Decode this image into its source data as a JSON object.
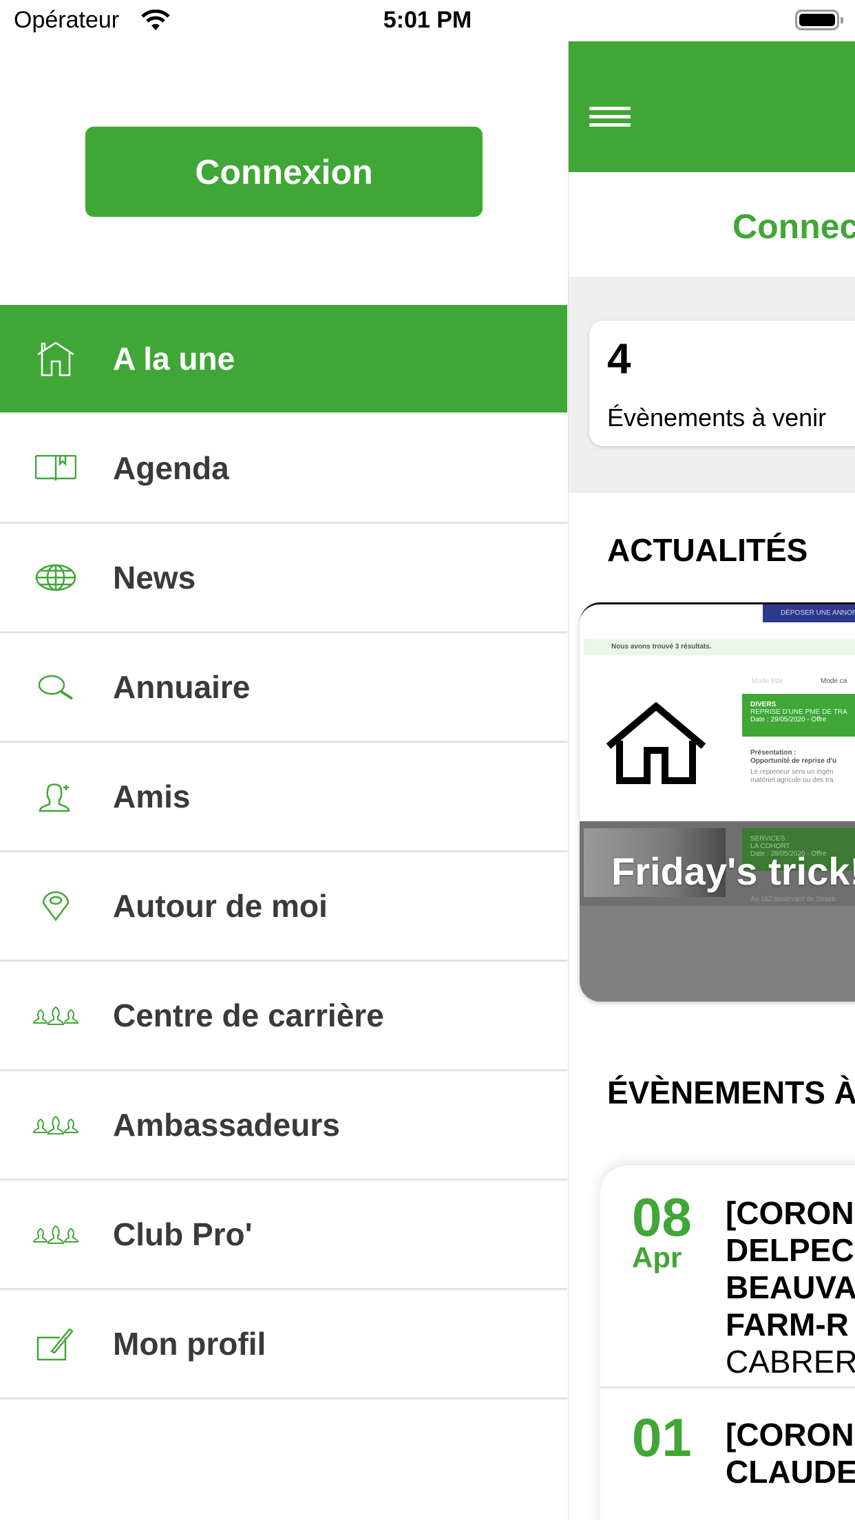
{
  "status_bar": {
    "carrier": "Opérateur",
    "time": "5:01 PM",
    "wifi_icon": "wifi-icon",
    "battery_icon": "battery-icon"
  },
  "drawer": {
    "login_label": "Connexion",
    "items": [
      {
        "label": "A la une",
        "icon": "home-icon",
        "active": true
      },
      {
        "label": "Agenda",
        "icon": "book-icon"
      },
      {
        "label": "News",
        "icon": "globe-icon"
      },
      {
        "label": "Annuaire",
        "icon": "search-icon"
      },
      {
        "label": "Amis",
        "icon": "add-friend-icon"
      },
      {
        "label": "Autour de moi",
        "icon": "location-pin-icon"
      },
      {
        "label": "Centre de carrière",
        "icon": "group-icon"
      },
      {
        "label": "Ambassadeurs",
        "icon": "group-icon"
      },
      {
        "label": "Club Pro'",
        "icon": "group-icon"
      },
      {
        "label": "Mon profil",
        "icon": "edit-icon"
      }
    ]
  },
  "main": {
    "menu_icon": "hamburger-icon",
    "connect_label": "Connect",
    "stat": {
      "value": "4",
      "label": "Évènements à venir"
    },
    "news_heading": "ACTUALITÉS",
    "news": [
      {
        "title": "Friday's trick!",
        "thumbnail_text": {
          "button": "DÉPOSER UNE ANNON",
          "result": "Nous avons trouvé 3 résultats.",
          "mode_list": "Mode liste",
          "mode_map": "Mode ca",
          "cat1": "DIVERS",
          "sub1": "REPRISE D'UNE PME DE TRA",
          "date1": "Date : 29/05/2020 - Offre",
          "pres_label": "Présentation :",
          "pres_title": "Opportunité de reprise d'u",
          "pres_text1": "Le repreneur sera un ingén",
          "pres_text2": "matériel agricole ou des tra",
          "cat2": "SERVICES",
          "sub2": "LA COHORT",
          "date2": "Date : 28/05/2020 - Offre",
          "addr2": "Au 162 boulevard de Strasb"
        }
      }
    ],
    "events_heading": "ÉVÈNEMENTS À",
    "events": [
      {
        "day": "08",
        "month": "Apr",
        "title_lines": [
          "[CORON",
          "DELPECH",
          "BEAUVA",
          "FARM-R"
        ],
        "location": "CABRERI"
      },
      {
        "day": "01",
        "title_lines": [
          "[CORON",
          "CLAUDE"
        ]
      }
    ]
  },
  "colors": {
    "accent": "#40A636",
    "text": "#3a3a3a",
    "band": "#efefef",
    "news_overlay": "#808080"
  }
}
